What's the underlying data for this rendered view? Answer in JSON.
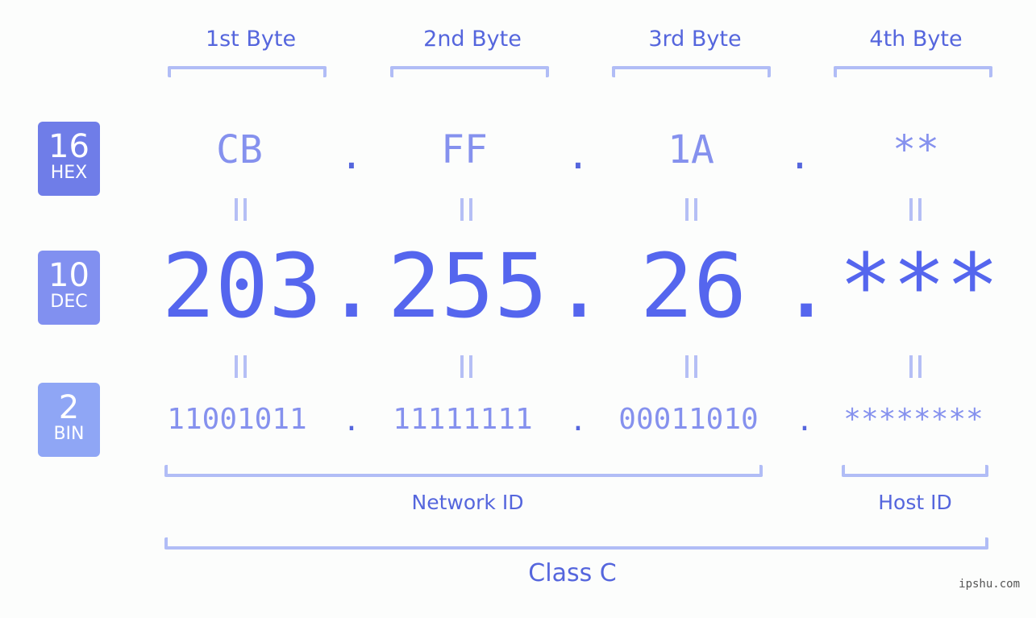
{
  "bytes": {
    "labels": [
      "1st Byte",
      "2nd Byte",
      "3rd Byte",
      "4th Byte"
    ]
  },
  "badges": {
    "hex": {
      "num": "16",
      "label": "HEX",
      "color": "#6f7de8"
    },
    "dec": {
      "num": "10",
      "label": "DEC",
      "color": "#8190f0"
    },
    "bin": {
      "num": "2",
      "label": "BIN",
      "color": "#8fa6f5"
    }
  },
  "hex": {
    "values": [
      "CB",
      "FF",
      "1A",
      "**"
    ]
  },
  "dec": {
    "values": [
      "203",
      "255",
      "26",
      "***"
    ]
  },
  "bin": {
    "values": [
      "11001011",
      "11111111",
      "00011010",
      "********"
    ]
  },
  "separator": ".",
  "equals": "II",
  "segments": {
    "network": "Network ID",
    "host": "Host ID",
    "class": "Class C"
  },
  "watermark": "ipshu.com",
  "colors": {
    "accent": "#5566ee",
    "light_accent": "#8591ee",
    "bracket": "#b1bdf6",
    "background": "#fcfdfc"
  }
}
